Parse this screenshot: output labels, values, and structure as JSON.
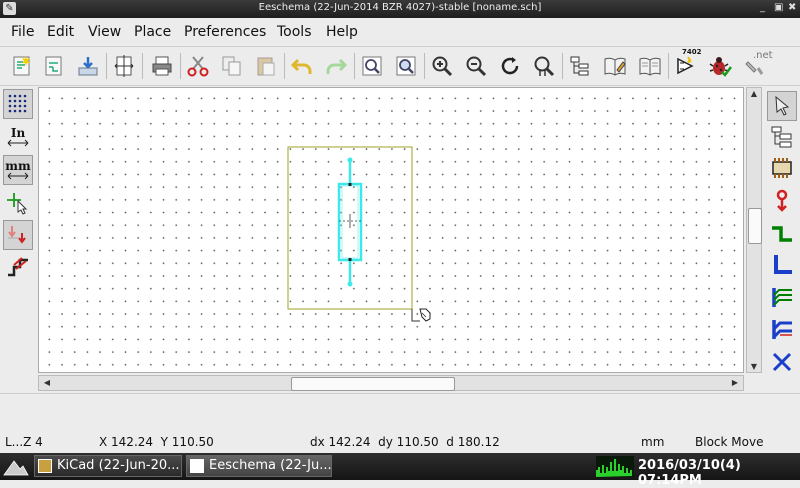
{
  "window": {
    "title": "Eeschema (22-Jun-2014 BZR 4027)-stable [noname.sch]",
    "controls": [
      "_",
      "▣",
      "✖"
    ]
  },
  "menu": [
    "File",
    "Edit",
    "View",
    "Place",
    "Preferences",
    "Tools",
    "Help"
  ],
  "toolbar": {
    "icons": [
      "new-schematic-icon",
      "new-sheet-icon",
      "load-icon",
      "page-settings-icon",
      "print-icon",
      "cut-icon",
      "copy-icon",
      "paste-icon",
      "undo-icon",
      "redo-icon",
      "find-icon",
      "find-replace-icon",
      "zoom-in-icon",
      "zoom-out-icon",
      "redraw-icon",
      "zoom-fit-icon",
      "hierarchy-icon",
      "library-editor-icon",
      "library-browser-icon",
      "netlist-icon",
      "erc-icon",
      "bom-icon"
    ],
    "netlist_badge": "7402",
    "bom_badge": ".net"
  },
  "left_toolbar": {
    "units_in": "In",
    "units_mm": "mm"
  },
  "status": {
    "zoom": "L...Z 4",
    "abs_coords": "X 142.24  Y 110.50",
    "rel_coords": "dx 142.24  dy 110.50  d 180.12",
    "units": "mm",
    "mode": "Block Move"
  },
  "taskbar": {
    "tasks": [
      "KiCad (22-Jun-20...",
      "Eeschema (22-Ju..."
    ],
    "clock": "2016/03/10(4) 07:14PM"
  },
  "colors": {
    "component": "#3ee8e8",
    "block": "#a0a020",
    "wire": "#008000",
    "bus": "#1a3fc8"
  }
}
